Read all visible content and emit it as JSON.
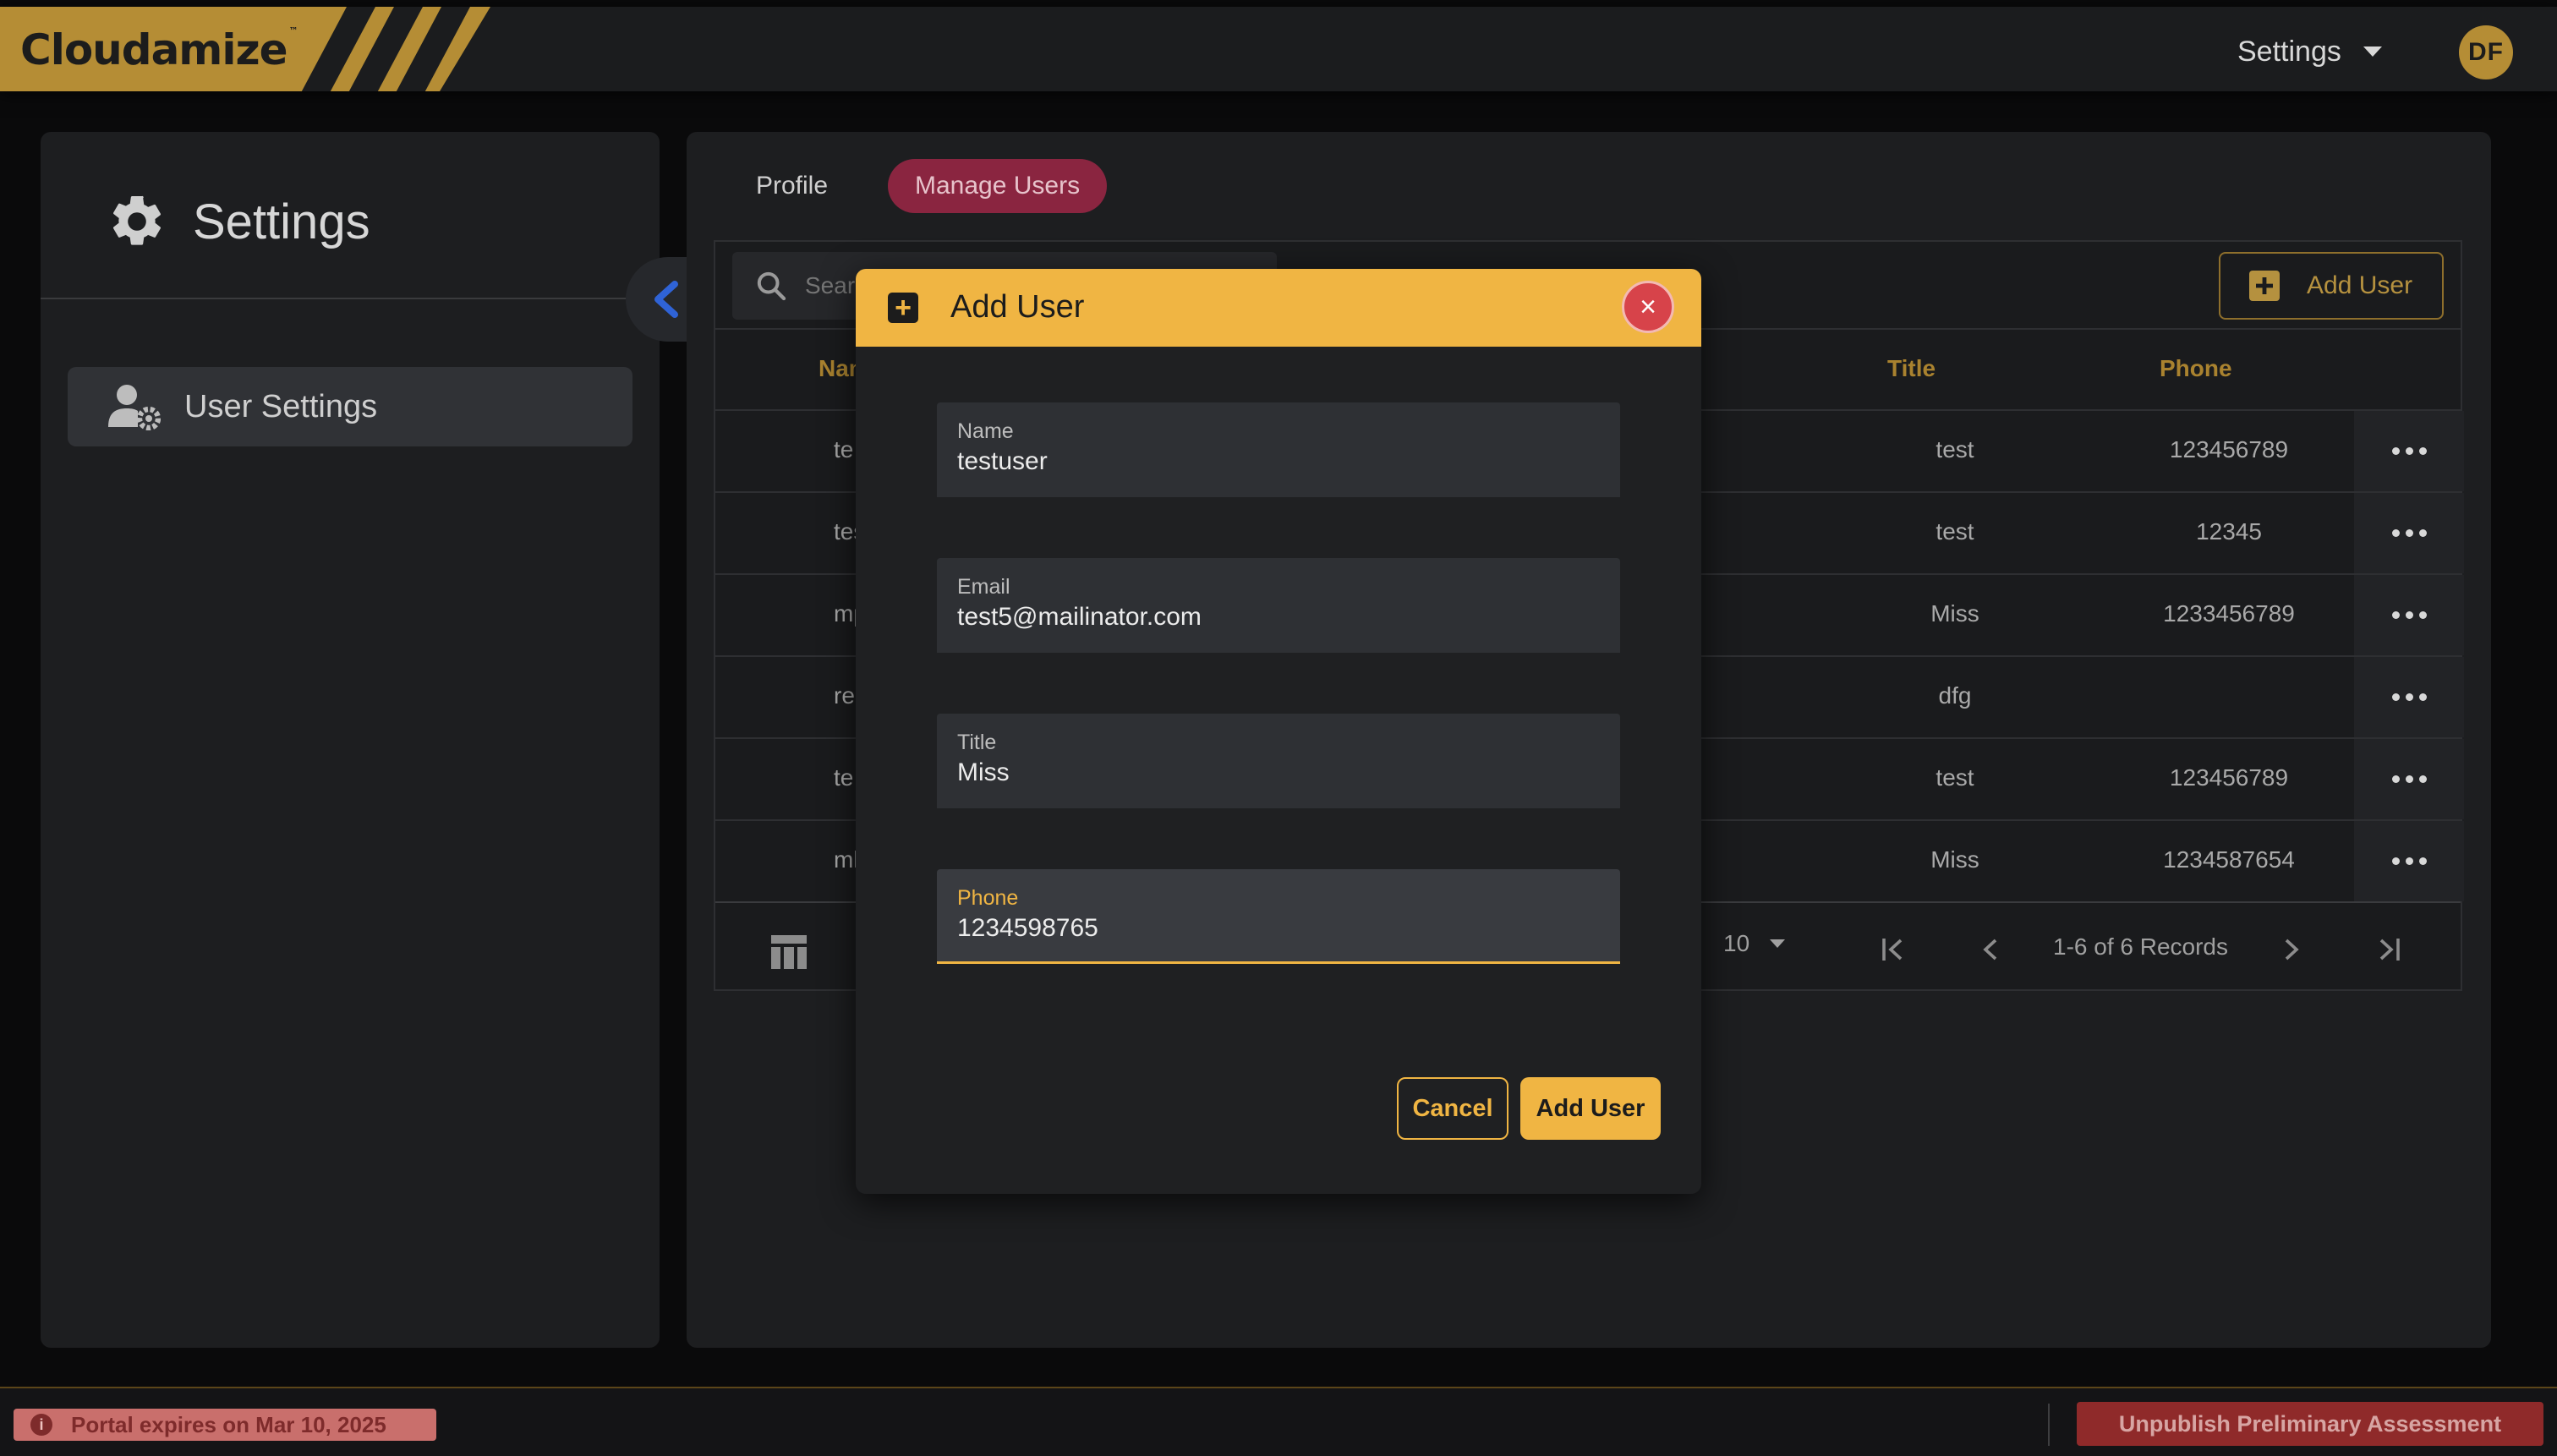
{
  "brand": {
    "name": "Cloudamize",
    "tm": "™",
    "color": "#b58d35"
  },
  "topbar": {
    "settings_label": "Settings",
    "avatar_initials": "DF"
  },
  "sidebar": {
    "title": "Settings",
    "items": [
      {
        "label": "User Settings",
        "icon": "user-gear-icon"
      }
    ]
  },
  "tabs": [
    {
      "label": "Profile",
      "active": false
    },
    {
      "label": "Manage Users",
      "active": true
    }
  ],
  "table": {
    "search_placeholder": "Search",
    "add_user_label": "Add User",
    "columns": [
      "Name",
      "Title",
      "Phone"
    ],
    "rows": [
      {
        "name": "te",
        "title": "test",
        "phone": "123456789"
      },
      {
        "name": "tes",
        "title": "test",
        "phone": "12345"
      },
      {
        "name": "mp",
        "title": "Miss",
        "phone": "1233456789"
      },
      {
        "name": "re",
        "title": "dfg",
        "phone": ""
      },
      {
        "name": "te",
        "title": "test",
        "phone": "123456789"
      },
      {
        "name": "mk",
        "title": "Miss",
        "phone": "1234587654"
      }
    ],
    "pagination": {
      "page_size": "10",
      "records": "1-6 of 6 Records"
    }
  },
  "modal": {
    "title": "Add User",
    "fields": [
      {
        "label": "Name",
        "value": "testuser"
      },
      {
        "label": "Email",
        "value": "test5@mailinator.com"
      },
      {
        "label": "Title",
        "value": "Miss"
      },
      {
        "label": "Phone",
        "value": "1234598765"
      }
    ],
    "cancel_label": "Cancel",
    "submit_label": "Add User",
    "accent": "#f0b543"
  },
  "bottombar": {
    "expiry_text": "Portal expires on Mar 10, 2025",
    "unpublish_label": "Unpublish Preliminary Assessment"
  }
}
